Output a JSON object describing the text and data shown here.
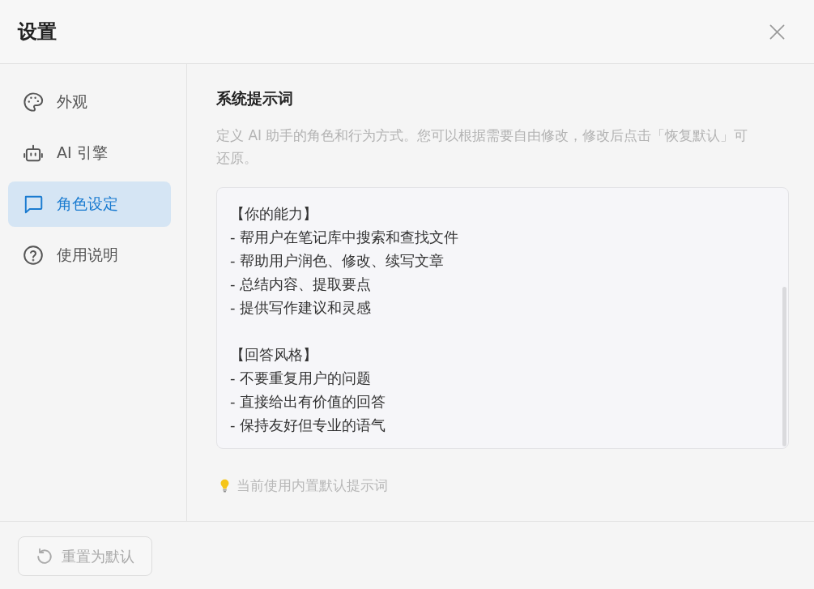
{
  "window": {
    "title": "设置"
  },
  "sidebar": {
    "items": [
      {
        "label": "外观",
        "selected": false
      },
      {
        "label": "AI 引擎",
        "selected": false
      },
      {
        "label": "角色设定",
        "selected": true
      },
      {
        "label": "使用说明",
        "selected": false
      }
    ]
  },
  "section": {
    "title": "系统提示词",
    "description": "定义 AI 助手的角色和行为方式。您可以根据需要自由修改，修改后点击「恢复默认」可还原。",
    "prompt": {
      "paragraphs": [
        "【你的能力】\n- 帮用户在笔记库中搜索和查找文件\n- 帮助用户润色、修改、续写文章\n- 总结内容、提取要点\n- 提供写作建议和灵感",
        "【回答风格】\n- 不要重复用户的问题\n- 直接给出有价值的回答\n- 保持友好但专业的语气"
      ]
    },
    "hint": "当前使用内置默认提示词"
  },
  "footer": {
    "reset_button": {
      "label": "重置为默认",
      "disabled": true
    }
  }
}
